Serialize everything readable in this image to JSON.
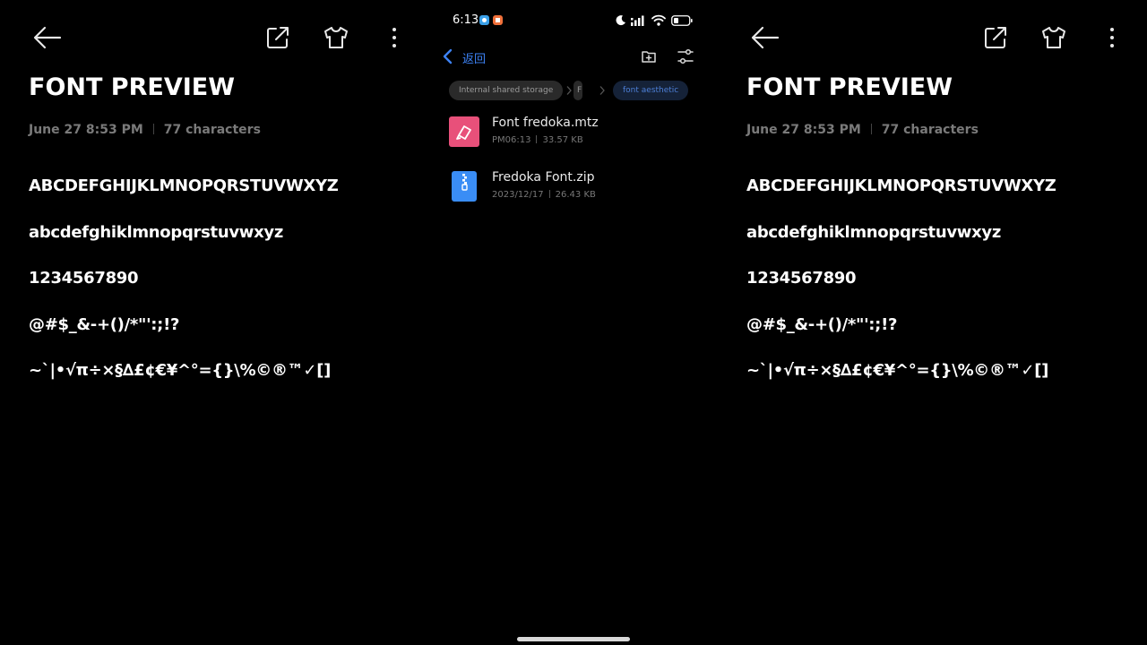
{
  "preview": {
    "title": "FONT PREVIEW",
    "date": "June 27 8:53 PM",
    "count": "77 characters",
    "samples": [
      "ABCDEFGHIJKLMNOPQRSTUVWXYZ",
      "abcdefghiklmnopqrstuvwxyz",
      "1234567890",
      "@#$_&-+()/*\"':;!?",
      "~`|•√π÷×§∆£¢€¥^°={}\\%©®™✓[]"
    ],
    "icons": [
      "arrow-left",
      "share",
      "t-shirt",
      "more-vertical"
    ]
  },
  "phone": {
    "status": {
      "time": "6:13",
      "icons": [
        "app-notification",
        "app-notification",
        "moon",
        "signal",
        "wifi",
        "battery"
      ]
    },
    "nav": {
      "back_label": "返回"
    },
    "breadcrumbs": [
      "Internal shared storage",
      "F",
      "font aesthetic"
    ],
    "files": [
      {
        "name": "Font fredoka.mtz",
        "time": "PM06:13",
        "size": "33.57 KB",
        "icon": "theme-file"
      },
      {
        "name": "Fredoka Font.zip",
        "time": "2023/12/17",
        "size": "26.43 KB",
        "icon": "zip-file"
      }
    ]
  },
  "colors": {
    "background": "#000000",
    "accent_blue": "#3d82f5",
    "mtz_pink": "#e8507a",
    "zip_blue": "#3a8df5"
  }
}
